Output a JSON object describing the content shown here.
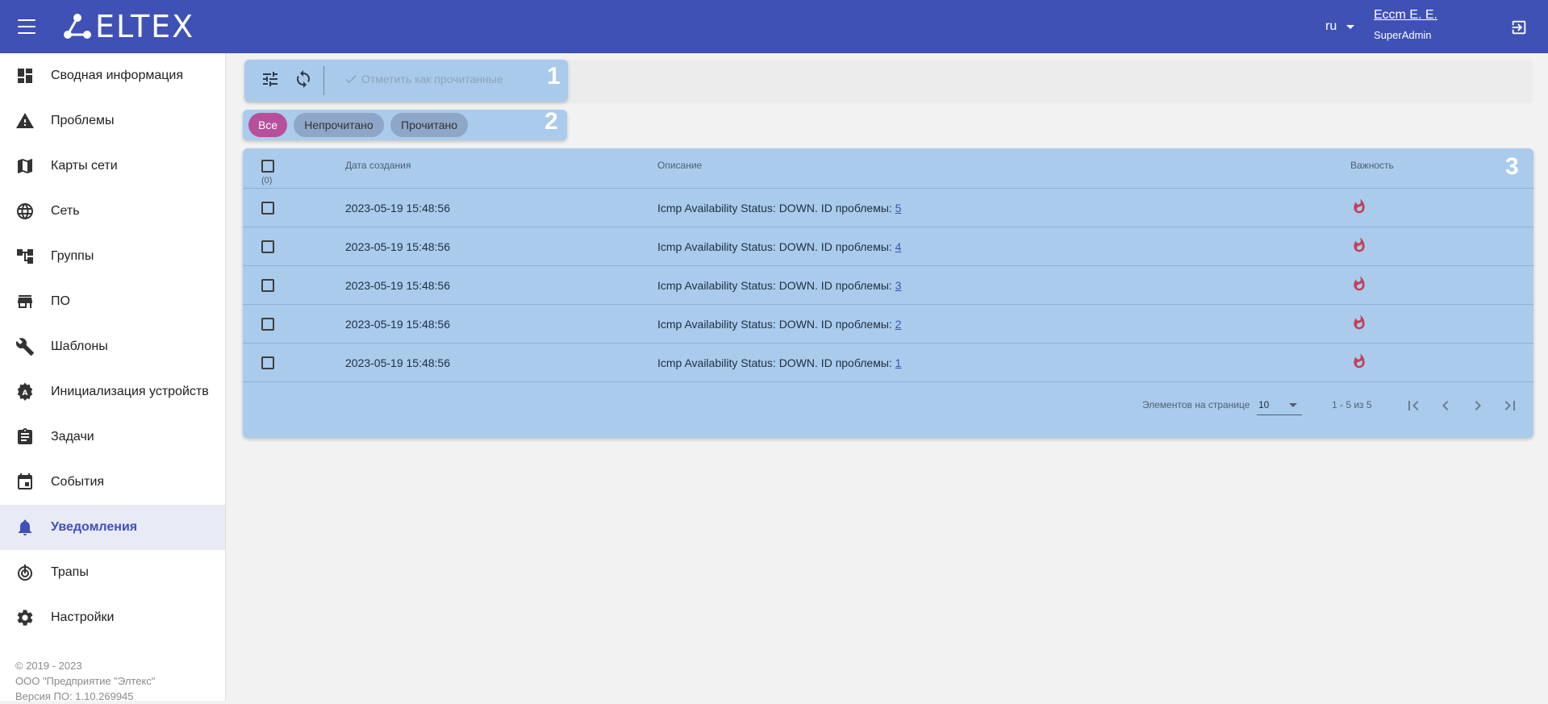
{
  "app": {
    "logo_text": "ELTEX"
  },
  "header": {
    "language": "ru",
    "user_name": "Ессm E. E.",
    "user_role": "SuperAdmin"
  },
  "sidebar": {
    "items": [
      {
        "label": "Сводная информация",
        "icon": "dashboard-icon"
      },
      {
        "label": "Проблемы",
        "icon": "warning-icon"
      },
      {
        "label": "Карты сети",
        "icon": "map-icon"
      },
      {
        "label": "Сеть",
        "icon": "globe-icon"
      },
      {
        "label": "Группы",
        "icon": "hierarchy-icon"
      },
      {
        "label": "ПО",
        "icon": "store-icon"
      },
      {
        "label": "Шаблоны",
        "icon": "wrench-icon"
      },
      {
        "label": "Инициализация устройств",
        "icon": "auto-settings-icon"
      },
      {
        "label": "Задачи",
        "icon": "clipboard-icon"
      },
      {
        "label": "События",
        "icon": "calendar-icon"
      },
      {
        "label": "Уведомления",
        "icon": "bell-icon",
        "active": true
      },
      {
        "label": "Трапы",
        "icon": "radar-icon"
      },
      {
        "label": "Настройки",
        "icon": "gear-icon"
      }
    ],
    "footer": {
      "line1": "© 2019 - 2023",
      "line2": "ООО \"Предприятие \"Элтекс\"",
      "line3": "Версия ПО: 1.10.269945"
    }
  },
  "toolbar": {
    "mark_read_label": "Отметить как прочитанные",
    "badge": "1"
  },
  "filters": {
    "badge": "2",
    "chips": [
      "Все",
      "Непрочитано",
      "Прочитано"
    ]
  },
  "table": {
    "badge": "3",
    "selected_count": "(0)",
    "columns": {
      "date": "Дата создания",
      "description": "Описание",
      "severity": "Важность"
    },
    "rows": [
      {
        "date": "2023-05-19 15:48:56",
        "description": "Icmp Availability Status: DOWN. ID проблемы: ",
        "problem_id": "5"
      },
      {
        "date": "2023-05-19 15:48:56",
        "description": "Icmp Availability Status: DOWN. ID проблемы: ",
        "problem_id": "4"
      },
      {
        "date": "2023-05-19 15:48:56",
        "description": "Icmp Availability Status: DOWN. ID проблемы: ",
        "problem_id": "3"
      },
      {
        "date": "2023-05-19 15:48:56",
        "description": "Icmp Availability Status: DOWN. ID проблемы: ",
        "problem_id": "2"
      },
      {
        "date": "2023-05-19 15:48:56",
        "description": "Icmp Availability Status: DOWN. ID проблемы: ",
        "problem_id": "1"
      }
    ],
    "pager": {
      "per_page_label": "Элементов на странице",
      "per_page_value": "10",
      "range": "1 - 5 из 5"
    }
  },
  "colors": {
    "primary": "#3f51b5",
    "highlight": "#9ec4eb",
    "chip_active": "#b84f9b",
    "severity": "#c2405a"
  }
}
